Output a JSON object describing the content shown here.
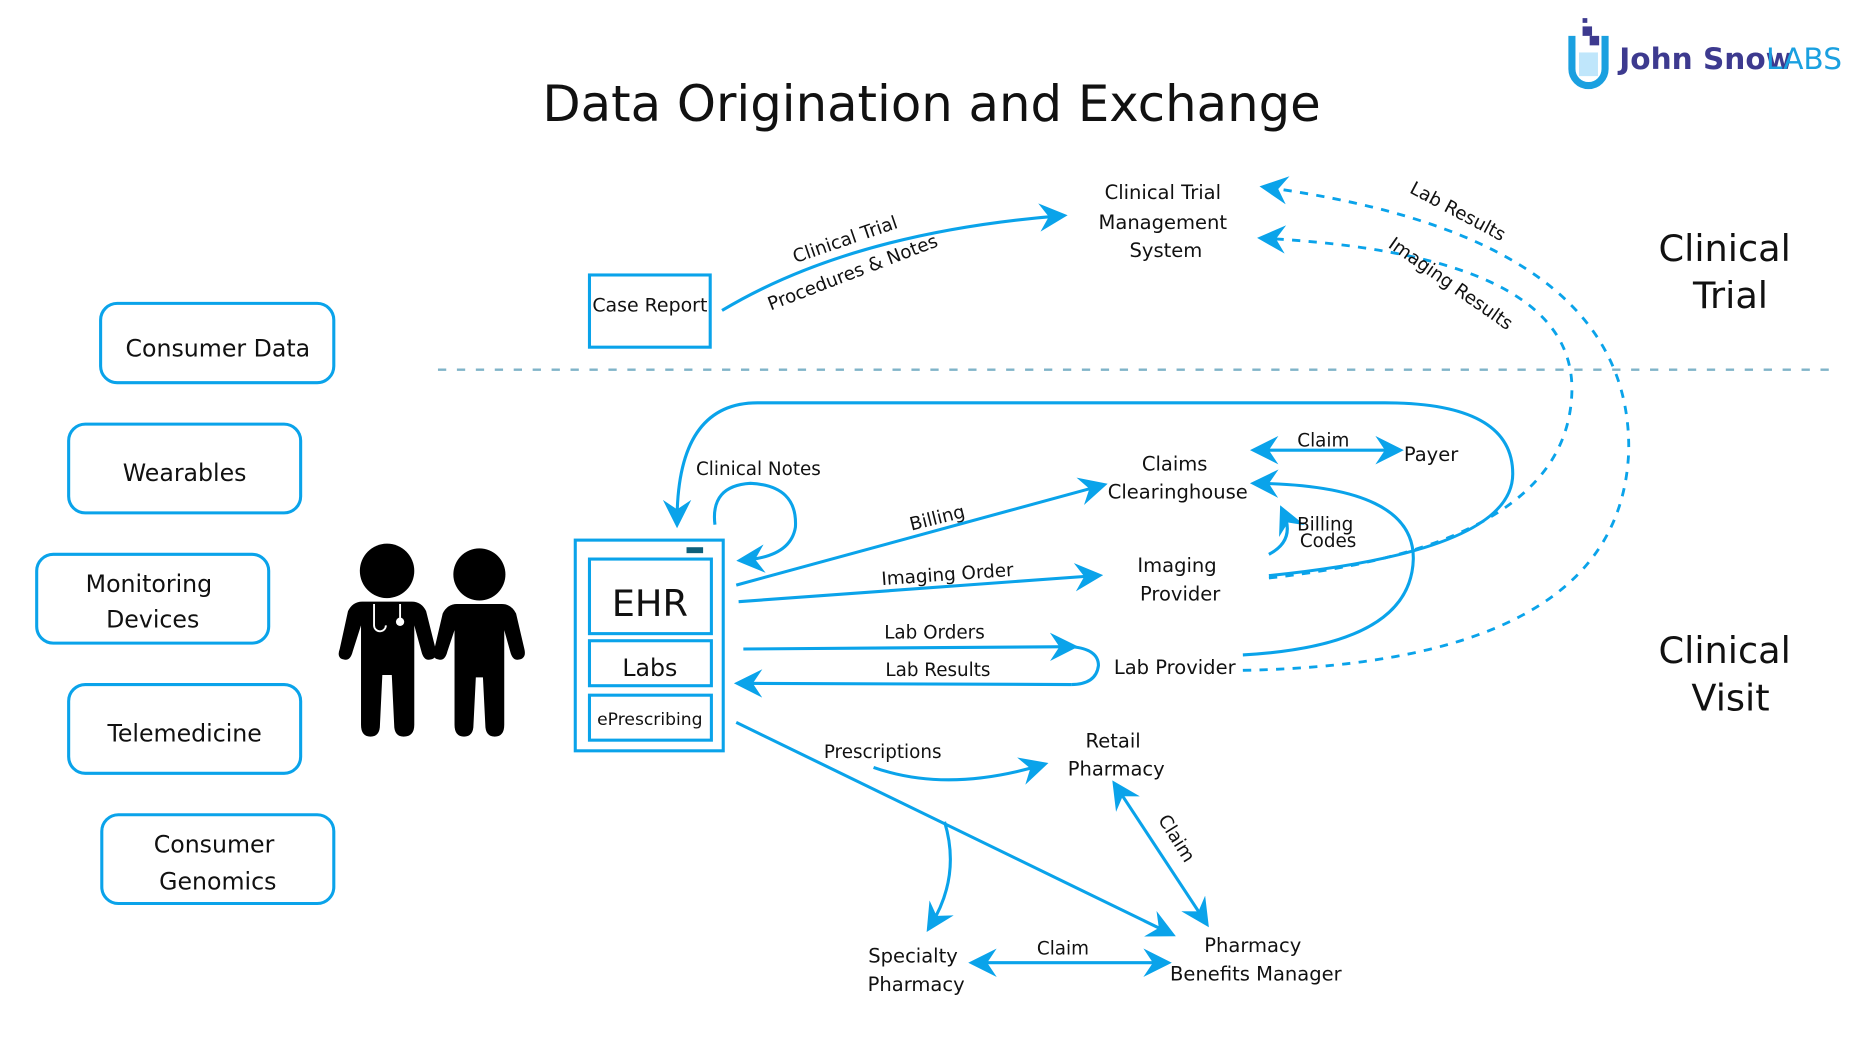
{
  "title": "Data Origination and Exchange",
  "logo": {
    "brand": "John Snow",
    "suffix": "LABS",
    "brand_color": "#3d3a8f",
    "suffix_color": "#1aa0e0"
  },
  "colors": {
    "accent": "#0aa3ea",
    "separator": "#7fb3c8",
    "ehr_indicator": "#0e5f7a",
    "text": "#111111"
  },
  "sections": {
    "clinical_trial": [
      "Clinical",
      "Trial"
    ],
    "clinical_visit": [
      "Clinical",
      "Visit"
    ]
  },
  "sources": [
    {
      "lines": [
        "Consumer Data"
      ]
    },
    {
      "lines": [
        "Wearables"
      ]
    },
    {
      "lines": [
        "Monitoring",
        "Devices"
      ]
    },
    {
      "lines": [
        "Telemedicine"
      ]
    },
    {
      "lines": [
        "Consumer",
        "Genomics"
      ]
    }
  ],
  "people_icon": "doctor-and-patient-icon",
  "ehr": {
    "main": "EHR",
    "labs": "Labs",
    "eprescribing": "ePrescribing"
  },
  "nodes": {
    "case_report": "Case Report",
    "ctms": [
      "Clinical Trial",
      "Management",
      "System"
    ],
    "claims_clearinghouse": [
      "Claims",
      "Clearinghouse"
    ],
    "payer": "Payer",
    "imaging_provider": [
      "Imaging",
      "Provider"
    ],
    "lab_provider": "Lab Provider",
    "retail_pharmacy": [
      "Retail",
      "Pharmacy"
    ],
    "specialty_pharmacy": [
      "Specialty",
      "Pharmacy"
    ],
    "pbm": [
      "Pharmacy",
      "Benefits Manager"
    ]
  },
  "edges": {
    "ct_procedures": [
      "Clinical Trial",
      "Procedures & Notes"
    ],
    "lab_results_ct": "Lab Results",
    "imaging_results_ct": "Imaging Results",
    "clinical_notes": "Clinical Notes",
    "billing": "Billing",
    "imaging_order": "Imaging Order",
    "lab_orders": "Lab Orders",
    "lab_results": "Lab Results",
    "claim_payer": "Claim",
    "billing_codes": [
      "Billing",
      "Codes"
    ],
    "prescriptions": "Prescriptions",
    "claim_retail": "Claim",
    "claim_specialty": "Claim"
  }
}
